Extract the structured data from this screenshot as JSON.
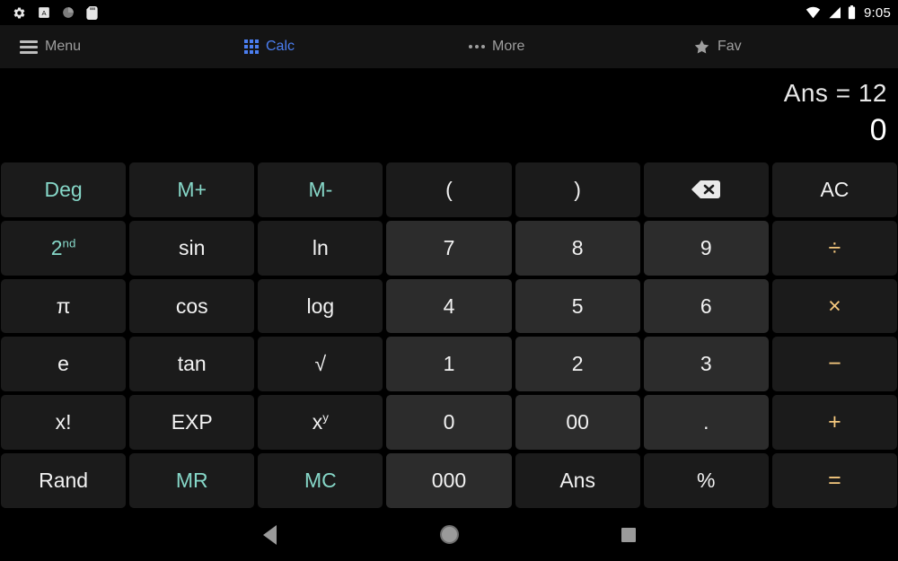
{
  "statusbar": {
    "time": "9:05",
    "left_icons": [
      "gear-icon",
      "a-box-icon",
      "circle-icon",
      "sd-card-icon"
    ],
    "right_icons": [
      "wifi-icon",
      "signal-icon",
      "battery-icon"
    ]
  },
  "appbar": {
    "items": [
      {
        "label": "Menu",
        "icon": "hamburger-icon",
        "active": false
      },
      {
        "label": "Calc",
        "icon": "grid-icon",
        "active": true
      },
      {
        "label": "More",
        "icon": "dots-icon",
        "active": false
      },
      {
        "label": "Fav",
        "icon": "star-icon",
        "active": false
      }
    ],
    "active_color": "#4b7ef0",
    "inactive_color": "#9e9e9e"
  },
  "display": {
    "ans_line": "Ans = 12",
    "main_line": "0"
  },
  "colors": {
    "teal": "#86d7c8",
    "operator": "#f5c87e",
    "function_key_bg": "#1b1b1b",
    "number_key_bg": "#2c2c2c",
    "screen_bg": "#000000"
  },
  "keypad": {
    "rows": [
      [
        {
          "label": "Deg",
          "style": "teal"
        },
        {
          "label": "M+",
          "style": "teal"
        },
        {
          "label": "M-",
          "style": "teal"
        },
        {
          "label": "(",
          "style": "fn"
        },
        {
          "label": ")",
          "style": "fn"
        },
        {
          "label": "",
          "style": "fn",
          "icon": "backspace-icon"
        },
        {
          "label": "AC",
          "style": "fn"
        }
      ],
      [
        {
          "label": "2",
          "sup": "nd",
          "style": "teal"
        },
        {
          "label": "sin",
          "style": "fn"
        },
        {
          "label": "ln",
          "style": "fn"
        },
        {
          "label": "7",
          "style": "num"
        },
        {
          "label": "8",
          "style": "num"
        },
        {
          "label": "9",
          "style": "num"
        },
        {
          "label": "÷",
          "style": "op"
        }
      ],
      [
        {
          "label": "π",
          "style": "fn"
        },
        {
          "label": "cos",
          "style": "fn"
        },
        {
          "label": "log",
          "style": "fn"
        },
        {
          "label": "4",
          "style": "num"
        },
        {
          "label": "5",
          "style": "num"
        },
        {
          "label": "6",
          "style": "num"
        },
        {
          "label": "×",
          "style": "op"
        }
      ],
      [
        {
          "label": "e",
          "style": "fn"
        },
        {
          "label": "tan",
          "style": "fn"
        },
        {
          "label": "√",
          "style": "fn"
        },
        {
          "label": "1",
          "style": "num"
        },
        {
          "label": "2",
          "style": "num"
        },
        {
          "label": "3",
          "style": "num"
        },
        {
          "label": "−",
          "style": "op"
        }
      ],
      [
        {
          "label": "x!",
          "style": "fn"
        },
        {
          "label": "EXP",
          "style": "fn"
        },
        {
          "label": "x",
          "sup": "y",
          "style": "fn"
        },
        {
          "label": "0",
          "style": "num"
        },
        {
          "label": "00",
          "style": "num"
        },
        {
          "label": ".",
          "style": "num"
        },
        {
          "label": "+",
          "style": "op"
        }
      ],
      [
        {
          "label": "Rand",
          "style": "fn"
        },
        {
          "label": "MR",
          "style": "teal"
        },
        {
          "label": "MC",
          "style": "teal"
        },
        {
          "label": "000",
          "style": "num"
        },
        {
          "label": "Ans",
          "style": "fn"
        },
        {
          "label": "%",
          "style": "fn"
        },
        {
          "label": "=",
          "style": "op"
        }
      ]
    ]
  },
  "navbar": {
    "buttons": [
      {
        "name": "back-button",
        "icon": "triangle-back-icon"
      },
      {
        "name": "home-button",
        "icon": "circle-home-icon"
      },
      {
        "name": "recents-button",
        "icon": "square-recents-icon"
      }
    ]
  }
}
